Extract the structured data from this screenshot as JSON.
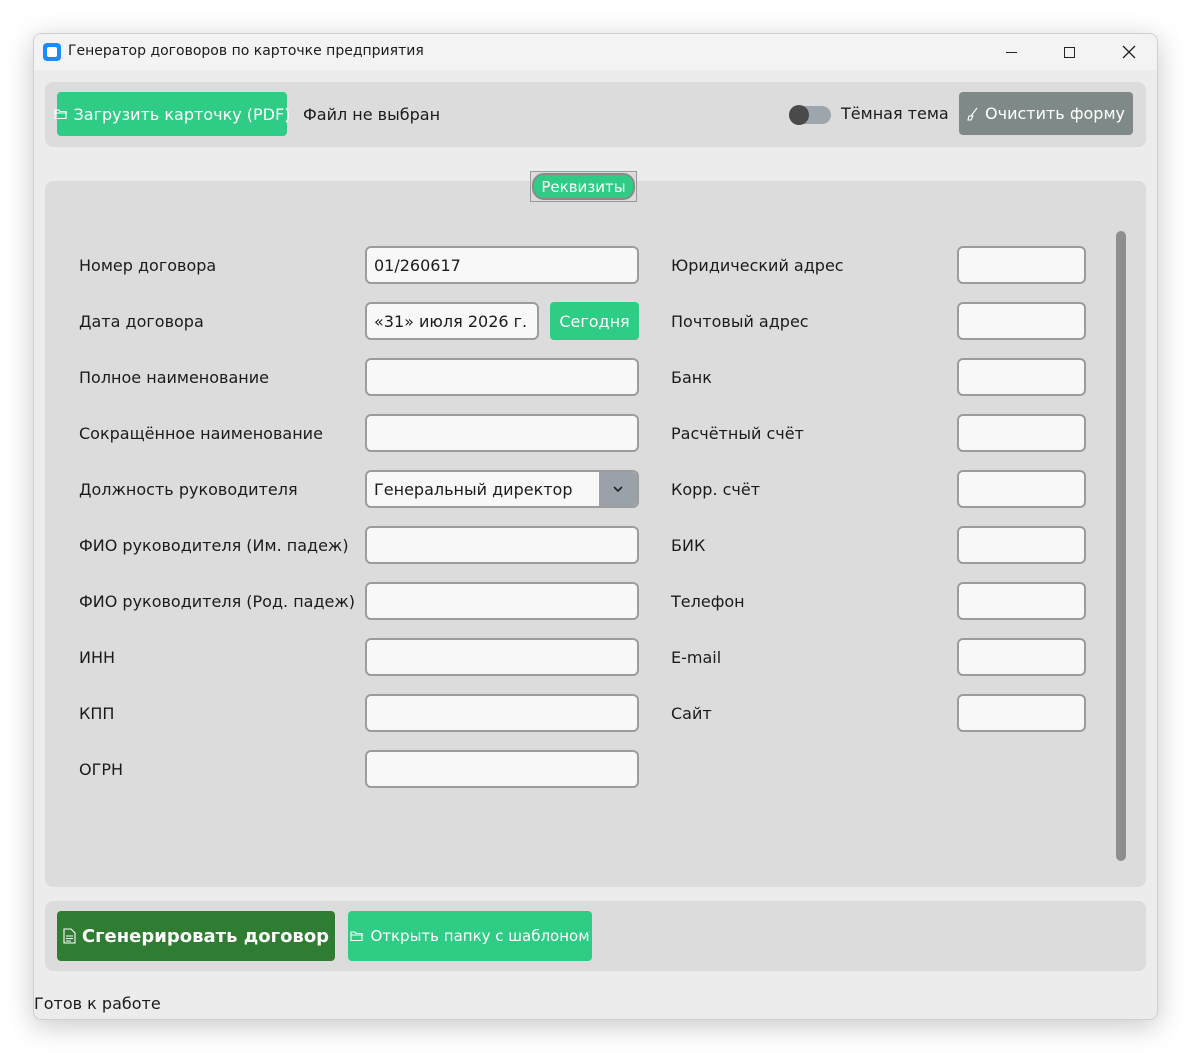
{
  "window": {
    "title": "Генератор договоров по карточке предприятия",
    "controls": {
      "minimize": "minimize",
      "maximize": "maximize",
      "close": "close"
    }
  },
  "toolbar": {
    "load_label": "Загрузить карточку (PDF)",
    "file_status": "Файл не выбран",
    "theme_label": "Тёмная тема",
    "theme_enabled": false,
    "clear_label": "Очистить форму"
  },
  "tab": {
    "label": "Реквизиты"
  },
  "form_left": [
    {
      "label": "Номер договора",
      "value": "01/260617"
    },
    {
      "label": "Дата договора",
      "value": "«31» июля 2026 г.",
      "button": "Сегодня"
    },
    {
      "label": "Полное наименование",
      "value": ""
    },
    {
      "label": "Сокращённое наименование",
      "value": ""
    },
    {
      "label": "Должность руководителя",
      "value": "Генеральный директор",
      "type": "select"
    },
    {
      "label": "ФИО руководителя (Им. падеж)",
      "value": ""
    },
    {
      "label": "ФИО руководителя (Род. падеж)",
      "value": ""
    },
    {
      "label": "ИНН",
      "value": ""
    },
    {
      "label": "КПП",
      "value": ""
    },
    {
      "label": "ОГРН",
      "value": ""
    }
  ],
  "form_right": [
    {
      "label": "Юридический адрес",
      "value": ""
    },
    {
      "label": "Почтовый адрес",
      "value": ""
    },
    {
      "label": "Банк",
      "value": ""
    },
    {
      "label": "Расчётный счёт",
      "value": ""
    },
    {
      "label": "Корр. счёт",
      "value": ""
    },
    {
      "label": "БИК",
      "value": ""
    },
    {
      "label": "Телефон",
      "value": ""
    },
    {
      "label": "E-mail",
      "value": ""
    },
    {
      "label": "Сайт",
      "value": ""
    }
  ],
  "actions": {
    "generate_label": "Сгенерировать договор",
    "open_folder_label": "Открыть папку с шаблоном"
  },
  "status": {
    "text": "Готов к работе"
  },
  "colors": {
    "accent_green": "#2ecc85",
    "dark_green": "#2e7d32",
    "gray_button": "#7f8a88",
    "panel_bg": "#dcdcdc",
    "window_bg": "#ececec"
  }
}
